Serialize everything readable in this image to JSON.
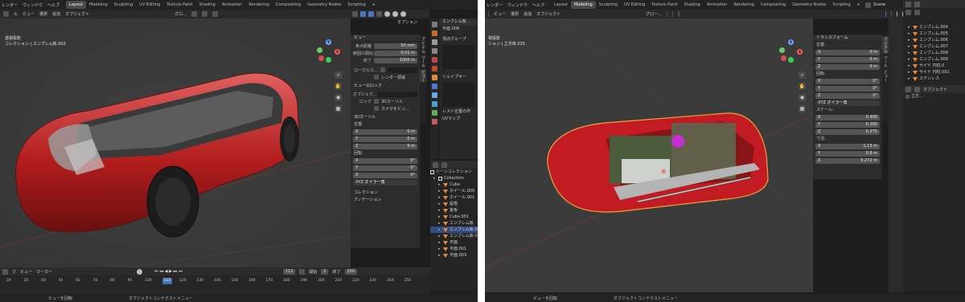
{
  "left": {
    "menu": [
      "レンダー",
      "ウィンドウ",
      "ヘルプ"
    ],
    "tabs": [
      "Layout",
      "Modeling",
      "Sculpting",
      "UV Editing",
      "Texture Paint",
      "Shading",
      "Animation",
      "Rendering",
      "Compositing",
      "Geometry Nodes",
      "Scripting"
    ],
    "active_tab": "Layout",
    "header2": [
      "ル",
      "ビュー",
      "選択",
      "追加",
      "オブジェクト"
    ],
    "glob_label": "グロ…",
    "header3_right": "オプション",
    "viewport_title": "透視投影",
    "viewport_collection": "コレクション | エンブレム板.002",
    "npanel": {
      "view_header": "ビュー",
      "focal_label": "焦点距離",
      "focal_value": "50 mm",
      "clip_start_label": "範囲の開始",
      "clip_start_value": "0.01 m",
      "clip_end_label": "終了",
      "clip_end_value": "1000 m",
      "local_camera_label": "ローカルカ…",
      "render_region_label": "レンダー領域",
      "view_lock_header": "ビューのロック",
      "object_label": "オブジェク…",
      "lock_label": "ロック",
      "lock_3d_cursor": "3Dカーソル",
      "lock_camera": "カメラをビュ…",
      "cursor_header": "3Dカーソル",
      "location_label": "位置:",
      "x_label": "X",
      "x_value": "0 m",
      "y_label": "Y",
      "y_value": "0 m",
      "z_label": "Z",
      "z_value": "0 m",
      "rotation_label": "回転:",
      "rx_value": "0°",
      "ry_value": "0°",
      "rz_value": "0°",
      "euler": "XYZ オイラー角",
      "collection_header": "コレクション",
      "annotation_header": "アノテーション"
    },
    "vtabs": [
      "アイテム",
      "ツール",
      "ビュー"
    ],
    "props": {
      "mesh_name": "エンブレム板…",
      "data_name": "平面.008",
      "vertex_groups": "頂点グループ",
      "shape_keys": "シェイプキー",
      "rest_pos": "レスト位置の作",
      "uv_maps": "UVマップ"
    },
    "outliner": {
      "scene_collection": "シーンコレクション",
      "items": [
        {
          "name": "Collection",
          "type": "coll"
        },
        {
          "name": "Cube",
          "type": "mesh"
        },
        {
          "name": "ホイール.000",
          "type": "mesh"
        },
        {
          "name": "ホイール.001",
          "type": "mesh"
        },
        {
          "name": "屋根",
          "type": "mesh"
        },
        {
          "name": "金板",
          "type": "mesh"
        },
        {
          "name": "Cube.001",
          "type": "mesh"
        },
        {
          "name": "エンブレム板",
          "type": "mesh"
        },
        {
          "name": "エンブレム板.0",
          "type": "mesh",
          "selected": true
        },
        {
          "name": "エンブレム板.0",
          "type": "mesh"
        },
        {
          "name": "平面",
          "type": "mesh"
        },
        {
          "name": "平面.001",
          "type": "mesh"
        },
        {
          "name": "平面.003",
          "type": "mesh"
        }
      ]
    },
    "timeline": {
      "menu": [
        "ク",
        "ビュー",
        "マーカー"
      ],
      "current_frame": "112",
      "start_label": "開始",
      "start_value": "1",
      "end_label": "終了",
      "end_value": "250",
      "ticks": [
        "20",
        "30",
        "40",
        "50",
        "60",
        "70",
        "80",
        "90",
        "100",
        "112",
        "120",
        "130",
        "140",
        "150",
        "160",
        "170",
        "180",
        "190",
        "200",
        "210",
        "220",
        "230",
        "240",
        "250"
      ]
    },
    "status": [
      "ビューを回転",
      "オブジェクトコンテクストメニュー"
    ]
  },
  "right": {
    "menu": [
      "レンダー",
      "ウィンドウ",
      "ヘルプ"
    ],
    "tabs": [
      "Layout",
      "Modeling",
      "Sculpting",
      "UV Editing",
      "Texture Paint",
      "Shading",
      "Animation",
      "Rendering",
      "Compositing",
      "Geometry Nodes",
      "Scripting"
    ],
    "active_tab": "Modeling",
    "scene": "Scene",
    "header2": [
      "ビュー",
      "選択",
      "追加",
      "オブジェクト"
    ],
    "glob_label": "グロー…",
    "viewport_title": "視投影",
    "viewport_collection": "ション | 立方体.015",
    "npanel": {
      "transform_header": "トランスフォーム",
      "location_label": "位置:",
      "x_label": "X",
      "y_label": "Y",
      "z_label": "Z",
      "lx": "0 m",
      "ly": "0 m",
      "lz": "0 m",
      "rotation_label": "回転:",
      "rx": "0°",
      "ry": "0°",
      "rz": "0°",
      "euler": "XYZ オイラー角",
      "scale_label": "スケール:",
      "sx": "0.400",
      "sy": "0.300",
      "sz": "0.275",
      "dimensions_label": "寸法:",
      "dx": "1.13 m",
      "dy": "0.6 m",
      "dz": "0.272 m"
    },
    "vtabs": [
      "アイテム",
      "ツール",
      "ビュー"
    ],
    "outliner": {
      "items": [
        {
          "name": "エンブレム.004"
        },
        {
          "name": "エンブレム.005"
        },
        {
          "name": "エンブレム.006"
        },
        {
          "name": "エンブレム.007"
        },
        {
          "name": "エンブレム.008"
        },
        {
          "name": "エンブレム.009"
        },
        {
          "name": "サイド 円柱.0"
        },
        {
          "name": "サイド 円柱.001"
        },
        {
          "name": "ステンレス"
        }
      ],
      "object_label": "オブジェクト",
      "mesh_label": "立方…"
    },
    "status": [
      "ビューを回転",
      "オブジェクトコンテクストメニュー"
    ]
  }
}
